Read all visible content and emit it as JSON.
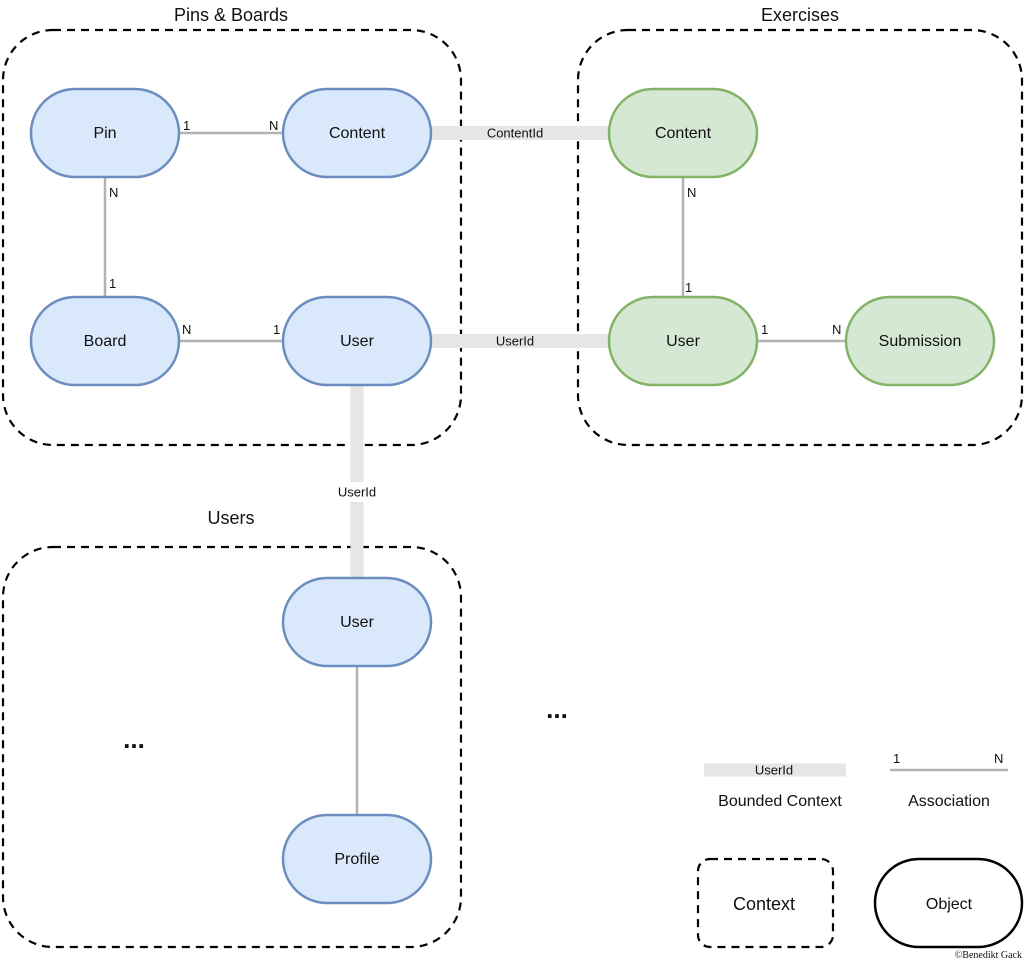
{
  "colors": {
    "node_blue_fill": "#dae8fc",
    "node_blue_stroke": "#6c8ebf",
    "node_green_fill": "#d5e8d4",
    "node_green_stroke": "#82b366",
    "association": "#b3b3b3",
    "bounded_context": "#e6e6e6"
  },
  "contexts": {
    "pins_boards": {
      "title": "Pins & Boards"
    },
    "exercises": {
      "title": "Exercises"
    },
    "users": {
      "title": "Users"
    }
  },
  "nodes": {
    "pin": "Pin",
    "pb_content": "Content",
    "board": "Board",
    "pb_user": "User",
    "ex_content": "Content",
    "ex_user": "User",
    "submission": "Submission",
    "users_user": "User",
    "profile": "Profile"
  },
  "associations": {
    "pin_content": {
      "from": "1",
      "to": "N"
    },
    "pin_board": {
      "from": "N",
      "to": "1"
    },
    "board_user": {
      "from": "N",
      "to": "1"
    },
    "excontent_exuser": {
      "from": "N",
      "to": "1"
    },
    "exuser_submission": {
      "from": "1",
      "to": "N"
    }
  },
  "bounded_links": {
    "content": "ContentId",
    "user_exercises": "UserId",
    "user_users": "UserId"
  },
  "ellipses": [
    "...",
    "..."
  ],
  "legend": {
    "bounded_sample": "UserId",
    "bounded_label": "Bounded Context",
    "assoc_from": "1",
    "assoc_to": "N",
    "assoc_label": "Association",
    "context_label": "Context",
    "object_label": "Object"
  },
  "copyright": "©Benedikt Gack"
}
